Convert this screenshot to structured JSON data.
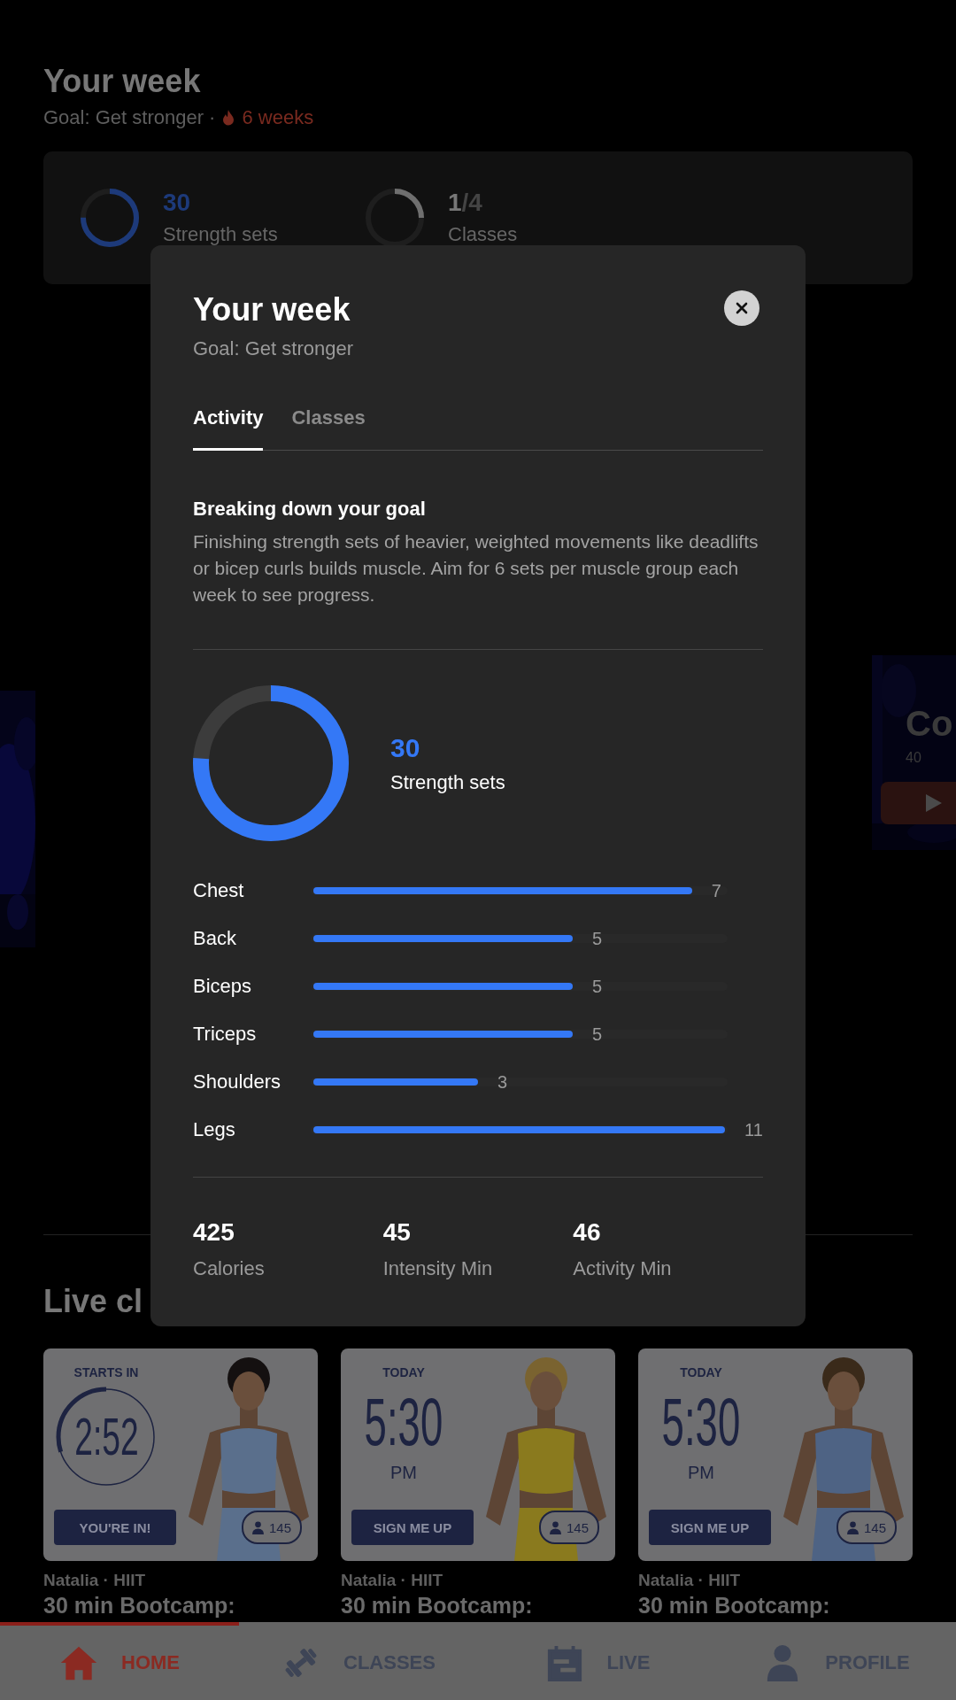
{
  "background": {
    "title": "Your week",
    "goal": "Goal: Get stronger ·",
    "streak": "6 weeks",
    "summary": [
      {
        "kind": "sets",
        "value": "30",
        "label": "Strength sets",
        "level": 0.75
      },
      {
        "kind": "fraction",
        "count": "1",
        "total": "/4",
        "label": "Classes",
        "level": 0.25
      }
    ],
    "featured": {
      "title": "Co",
      "subtitle": "40"
    },
    "section_title": "Live cl",
    "classes": [
      {
        "kind": "countdown",
        "caption": "STARTS IN",
        "time": "2:52",
        "level": 0.3,
        "button": "YOU'RE IN!",
        "attendees": "145",
        "instructor": "Natalia · HIIT",
        "title": "30 min Bootcamp:"
      },
      {
        "kind": "scheduled",
        "caption": "TODAY",
        "time": "5:30",
        "period": "PM",
        "button": "SIGN ME UP",
        "attendees": "145",
        "instructor": "Natalia · HIIT",
        "title": "30 min Bootcamp:"
      },
      {
        "kind": "scheduled",
        "caption": "TODAY",
        "time": "5:30",
        "period": "PM",
        "button": "SIGN ME UP",
        "attendees": "145",
        "instructor": "Natalia · HIIT",
        "title": "30 min Bootcamp:"
      }
    ]
  },
  "modal": {
    "title": "Your week",
    "subtitle": "Goal: Get stronger",
    "tabs": [
      {
        "label": "Activity",
        "selected": true
      },
      {
        "label": "Classes",
        "selected": false
      }
    ],
    "heading": "Breaking down your goal",
    "description": "Finishing strength sets of heavier, weighted movements like deadlifts or bicep curls builds muscle. Aim for 6 sets per muscle group each week to see progress.",
    "total": {
      "value": "30",
      "label": "Strength sets",
      "level": 0.76
    },
    "muscles": [
      {
        "name": "Chest",
        "level": 0.92,
        "reading": "7"
      },
      {
        "name": "Back",
        "level": 0.63,
        "reading": "5"
      },
      {
        "name": "Biceps",
        "level": 0.63,
        "reading": "5"
      },
      {
        "name": "Triceps",
        "level": 0.63,
        "reading": "5"
      },
      {
        "name": "Shoulders",
        "level": 0.4,
        "reading": "3"
      },
      {
        "name": "Legs",
        "level": 1,
        "reading": "11"
      }
    ],
    "stats": [
      {
        "value": "425",
        "label": "Calories"
      },
      {
        "value": "45",
        "label": "Intensity Min"
      },
      {
        "value": "46",
        "label": "Activity Min"
      }
    ]
  },
  "nav": [
    {
      "label": "HOME",
      "selected": true
    },
    {
      "label": "CLASSES",
      "selected": false
    },
    {
      "label": "LIVE",
      "selected": false
    },
    {
      "label": "PROFILE",
      "selected": false
    }
  ]
}
